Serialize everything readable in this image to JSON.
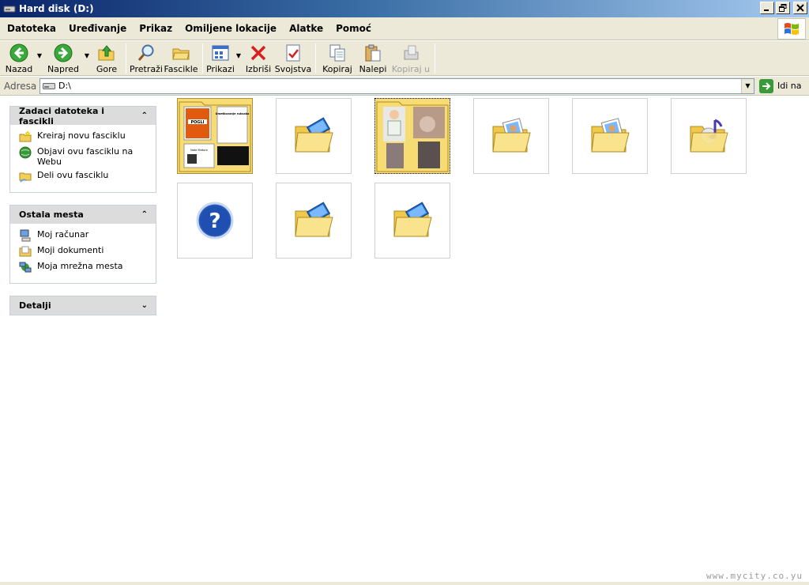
{
  "window": {
    "title": "Hard disk (D:)"
  },
  "menubar": {
    "items": [
      "Datoteka",
      "Uređivanje",
      "Prikaz",
      "Omiljene lokacije",
      "Alatke",
      "Pomoć"
    ]
  },
  "toolbar": {
    "back": "Nazad",
    "forward": "Napred",
    "up": "Gore",
    "search": "Pretraži",
    "folders": "Fascikle",
    "views": "Prikazi",
    "delete": "Izbriši",
    "properties": "Svojstva",
    "copy": "Kopiraj",
    "paste": "Nalepi",
    "copy_to": "Kopiraj u"
  },
  "address": {
    "label": "Adresa",
    "value": "D:\\",
    "go": "Idi na"
  },
  "tasks": {
    "title": "Zadaci datoteka i fascikli",
    "items": [
      "Kreiraj novu fasciklu",
      "Objavi ovu fasciklu na Webu",
      "Deli ovu fasciklu"
    ]
  },
  "other_places": {
    "title": "Ostala mesta",
    "items": [
      "Moj računar",
      "Moji dokumenti",
      "Moja mrežna mesta"
    ]
  },
  "details": {
    "title": "Detalji"
  },
  "thumb_texts": {
    "poster_small": "POGLI",
    "page_title": "Umetkovanje ruksaka",
    "page_sub": "Note Mature"
  },
  "watermark": "www.mycity.co.yu",
  "colors": {
    "title_start": "#0a246a",
    "title_end": "#a6caf0",
    "chrome": "#ece9d8",
    "folder": "#f7dc74"
  }
}
